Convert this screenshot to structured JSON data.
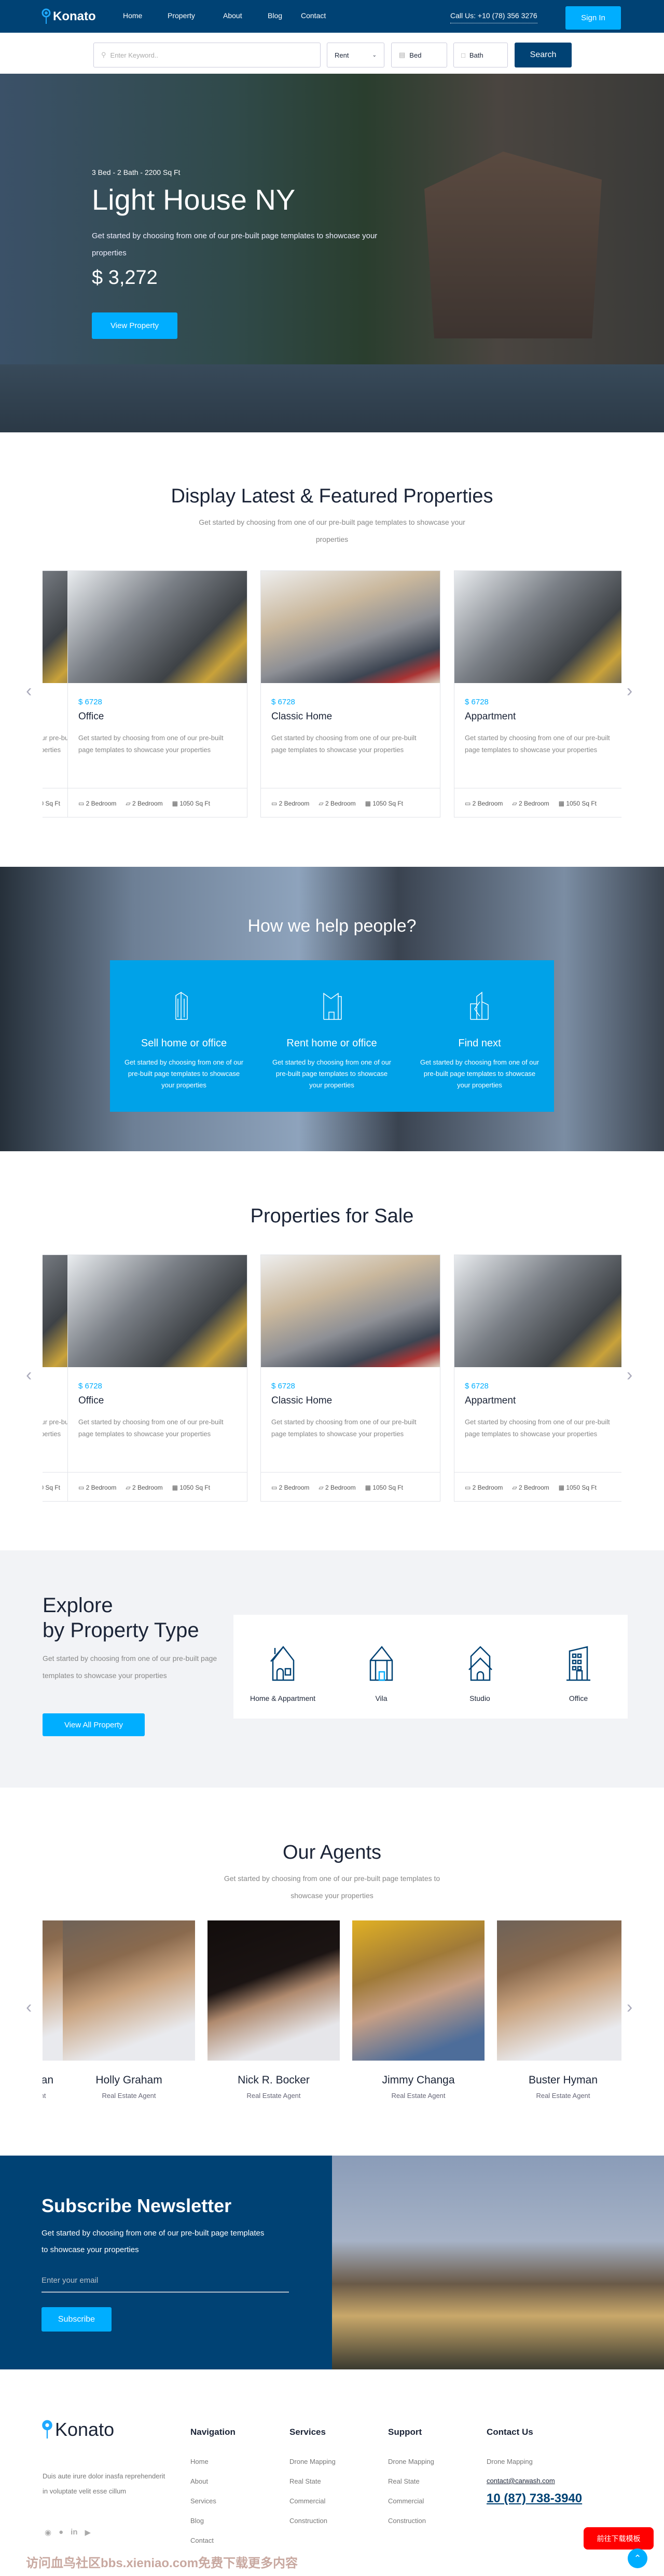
{
  "nav": {
    "brand": "Konato",
    "links": [
      "Home",
      "Property",
      "About",
      "Blog",
      "Contact"
    ],
    "call": "Call Us: +10 (78) 356 3276",
    "signin": "Sign In"
  },
  "search": {
    "placeholder": "Enter Keyword..",
    "type": "Rent",
    "bed": "Bed",
    "bath": "Bath",
    "button": "Search"
  },
  "hero": {
    "meta": "3 Bed - 2 Bath - 2200 Sq Ft",
    "title": "Light House NY",
    "desc": "Get started by choosing from one of our pre-built page templates to showcase your properties",
    "price": "$ 3,272",
    "button": "View Property"
  },
  "featured": {
    "title": "Display Latest & Featured Properties",
    "subtitle": "Get started by choosing from one of our pre-built page templates to showcase your properties",
    "cards": [
      {
        "price": "$ 6728",
        "title": "Office",
        "desc": "Get started by choosing from one of our pre-built page templates to showcase your properties",
        "beds": "2 Bedroom",
        "baths": "2 Bedroom",
        "area": "1050 Sq Ft"
      },
      {
        "price": "$ 6728",
        "title": "Classic Home",
        "desc": "Get started by choosing from one of our pre-built page templates to showcase your properties",
        "beds": "2 Bedroom",
        "baths": "2 Bedroom",
        "area": "1050 Sq Ft"
      },
      {
        "price": "$ 6728",
        "title": "Appartment",
        "desc": "Get started by choosing from one of our pre-built page templates to showcase your properties",
        "beds": "2 Bedroom",
        "baths": "2 Bedroom",
        "area": "1050 Sq Ft"
      }
    ]
  },
  "help": {
    "title": "How we help people?",
    "items": [
      {
        "title": "Sell home or office",
        "desc": "Get started by choosing from one of our pre-built page templates to showcase your properties",
        "icon": "buildings-icon"
      },
      {
        "title": "Rent home or office",
        "desc": "Get started by choosing from one of our pre-built page templates to showcase your properties",
        "icon": "office-building-icon"
      },
      {
        "title": "Find next",
        "desc": "Get started by choosing from one of our pre-built page templates to showcase your properties",
        "icon": "skyscraper-icon"
      }
    ]
  },
  "sale": {
    "title": "Properties for Sale",
    "cards": [
      {
        "price": "$ 6728",
        "title": "Office",
        "desc": "Get started by choosing from one of our pre-built page templates to showcase your properties",
        "beds": "2 Bedroom",
        "baths": "2 Bedroom",
        "area": "1050 Sq Ft"
      },
      {
        "price": "$ 6728",
        "title": "Classic Home",
        "desc": "Get started by choosing from one of our pre-built page templates to showcase your properties",
        "beds": "2 Bedroom",
        "baths": "2 Bedroom",
        "area": "1050 Sq Ft"
      },
      {
        "price": "$ 6728",
        "title": "Appartment",
        "desc": "Get started by choosing from one of our pre-built page templates to showcase your properties",
        "beds": "2 Bedroom",
        "baths": "2 Bedroom",
        "area": "1050 Sq Ft"
      }
    ]
  },
  "explore": {
    "title1": "Explore",
    "title2": "by Property Type",
    "desc": "Get started by choosing from one of our pre-built page templates to showcase your properties",
    "button": "View All Property",
    "types": [
      "Home & Appartment",
      "Vila",
      "Studio",
      "Office"
    ]
  },
  "agents": {
    "title": "Our Agents",
    "subtitle": "Get started by choosing from one of our pre-built page templates to showcase your properties",
    "list": [
      {
        "name": "Holly Graham",
        "role": "Real Estate Agent"
      },
      {
        "name": "Nick R. Bocker",
        "role": "Real Estate Agent"
      },
      {
        "name": "Jimmy Changa",
        "role": "Real Estate Agent"
      },
      {
        "name": "Buster Hyman",
        "role": "Real Estate Agent"
      }
    ]
  },
  "newsletter": {
    "title": "Subscribe Newsletter",
    "desc": "Get started by choosing from one of our pre-built page templates to showcase your properties",
    "placeholder": "Enter your email",
    "button": "Subscribe"
  },
  "footer": {
    "brand": "Konato",
    "about": "Duis aute irure dolor inasfa reprehenderit in voluptate velit esse cillum",
    "socials": [
      "instagram-icon",
      "facebook-icon",
      "linkedin-icon",
      "youtube-icon"
    ],
    "columns": [
      {
        "title": "Navigation",
        "items": [
          "Home",
          "About",
          "Services",
          "Blog",
          "Contact"
        ]
      },
      {
        "title": "Services",
        "items": [
          "Drone Mapping",
          "Real State",
          "Commercial",
          "Construction"
        ]
      },
      {
        "title": "Support",
        "items": [
          "Drone Mapping",
          "Real State",
          "Commercial",
          "Construction"
        ]
      }
    ],
    "contact": {
      "title": "Contact Us",
      "label": "Drone Mapping",
      "email": "contact@carwash.com",
      "phone": "10 (87) 738-3940"
    },
    "watermark": "访问血鸟社区bbs.xieniao.com免费下载更多内容",
    "download": "前往下载模板"
  },
  "colors": {
    "navy": "#004274",
    "accent": "#00aeff",
    "help": "#00a2e8"
  }
}
